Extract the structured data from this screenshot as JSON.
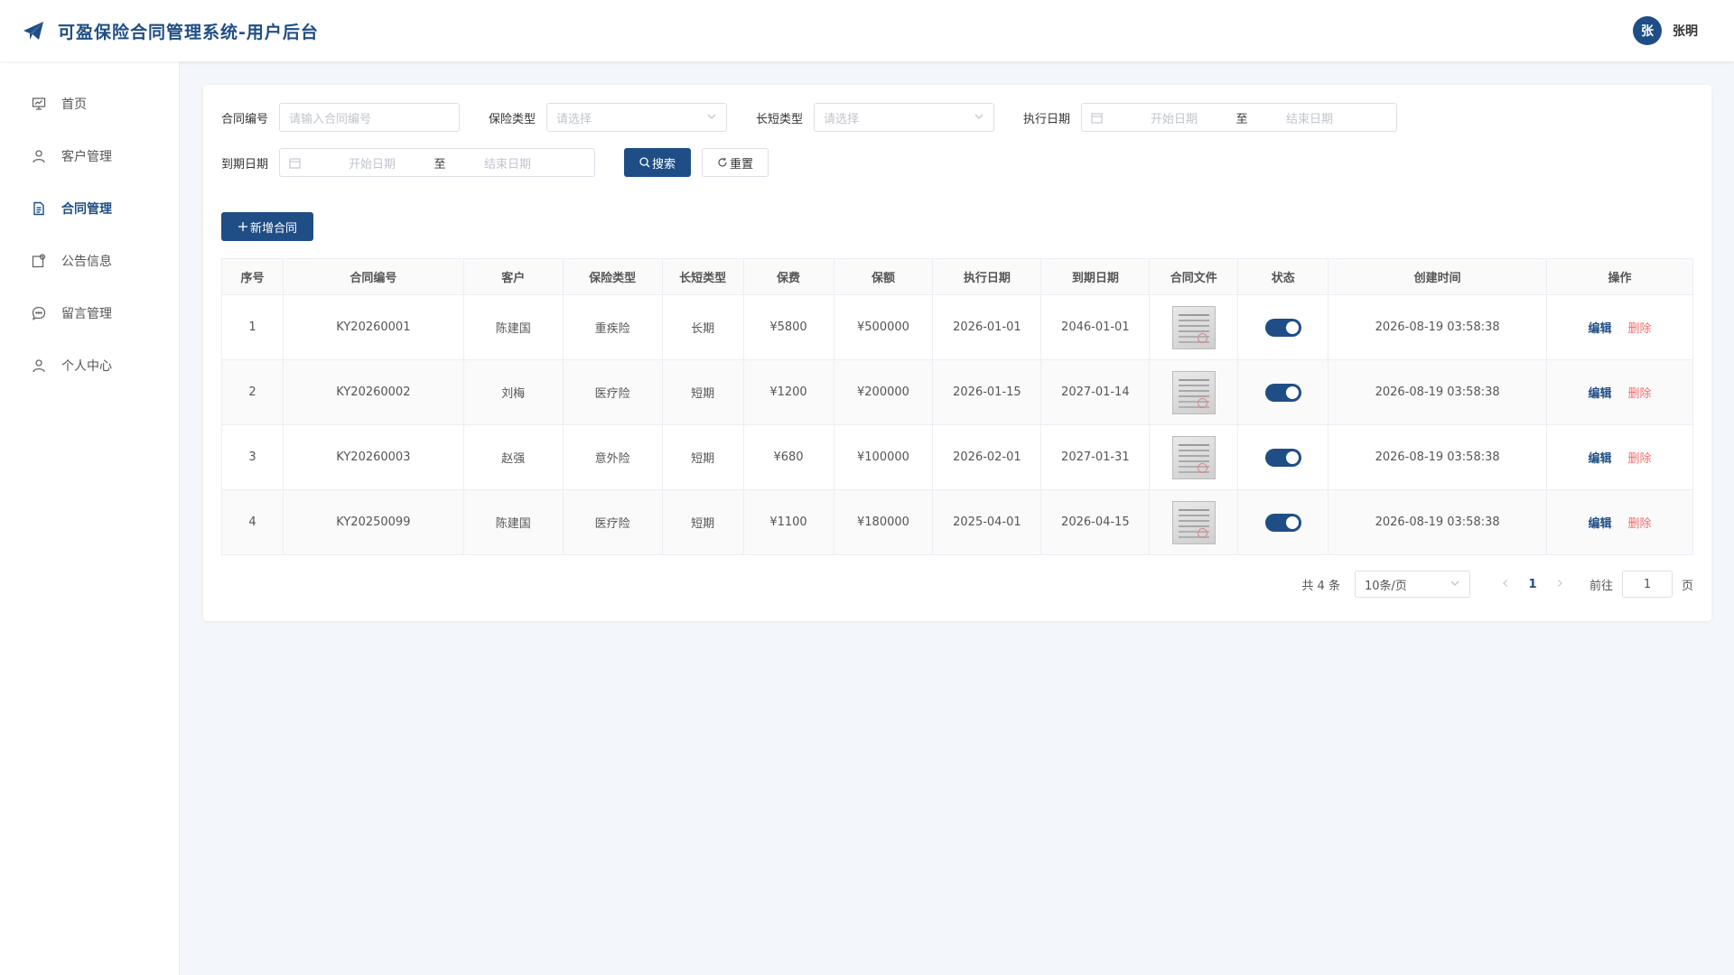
{
  "header": {
    "title": "可盈保险合同管理系统-用户后台",
    "avatar_text": "张",
    "username": "张明"
  },
  "sidebar": {
    "items": [
      {
        "label": "首页",
        "icon": "dashboard-icon"
      },
      {
        "label": "客户管理",
        "icon": "user-icon"
      },
      {
        "label": "合同管理",
        "icon": "document-icon",
        "active": true
      },
      {
        "label": "公告信息",
        "icon": "notice-icon"
      },
      {
        "label": "留言管理",
        "icon": "message-icon"
      },
      {
        "label": "个人中心",
        "icon": "user-icon"
      }
    ]
  },
  "search": {
    "contract_no_label": "合同编号",
    "contract_no_placeholder": "请输入合同编号",
    "insurance_type_label": "保险类型",
    "insurance_type_placeholder": "请选择",
    "term_type_label": "长短类型",
    "term_type_placeholder": "请选择",
    "exec_date_label": "执行日期",
    "expire_date_label": "到期日期",
    "start_placeholder": "开始日期",
    "end_placeholder": "结束日期",
    "range_separator": "至",
    "search_button": "搜索",
    "reset_button": "重置"
  },
  "actions": {
    "add_button": "新增合同"
  },
  "table": {
    "columns": [
      "序号",
      "合同编号",
      "客户",
      "保险类型",
      "长短类型",
      "保费",
      "保额",
      "执行日期",
      "到期日期",
      "合同文件",
      "状态",
      "创建时间",
      "操作"
    ],
    "rows": [
      {
        "index": "1",
        "no": "KY20260001",
        "customer": "陈建国",
        "type": "重疾险",
        "term": "长期",
        "premium": "¥5800",
        "amount": "¥500000",
        "exec_date": "2026-01-01",
        "expire_date": "2046-01-01",
        "status_on": true,
        "created": "2026-08-19 03:58:38",
        "edit": "编辑",
        "delete": "删除"
      },
      {
        "index": "2",
        "no": "KY20260002",
        "customer": "刘梅",
        "type": "医疗险",
        "term": "短期",
        "premium": "¥1200",
        "amount": "¥200000",
        "exec_date": "2026-01-15",
        "expire_date": "2027-01-14",
        "status_on": true,
        "created": "2026-08-19 03:58:38",
        "edit": "编辑",
        "delete": "删除"
      },
      {
        "index": "3",
        "no": "KY20260003",
        "customer": "赵强",
        "type": "意外险",
        "term": "短期",
        "premium": "¥680",
        "amount": "¥100000",
        "exec_date": "2026-02-01",
        "expire_date": "2027-01-31",
        "status_on": true,
        "created": "2026-08-19 03:58:38",
        "edit": "编辑",
        "delete": "删除"
      },
      {
        "index": "4",
        "no": "KY20250099",
        "customer": "陈建国",
        "type": "医疗险",
        "term": "短期",
        "premium": "¥1100",
        "amount": "¥180000",
        "exec_date": "2025-04-01",
        "expire_date": "2026-04-15",
        "status_on": true,
        "created": "2026-08-19 03:58:38",
        "edit": "编辑",
        "delete": "删除"
      }
    ]
  },
  "pagination": {
    "total": "共 4 条",
    "page_size": "10条/页",
    "current_page": "1",
    "goto_label": "前往",
    "goto_value": "1",
    "page_suffix": "页"
  },
  "colors": {
    "primary": "#1f4e86",
    "danger": "#f56c6c",
    "background": "#f3f6fa"
  }
}
